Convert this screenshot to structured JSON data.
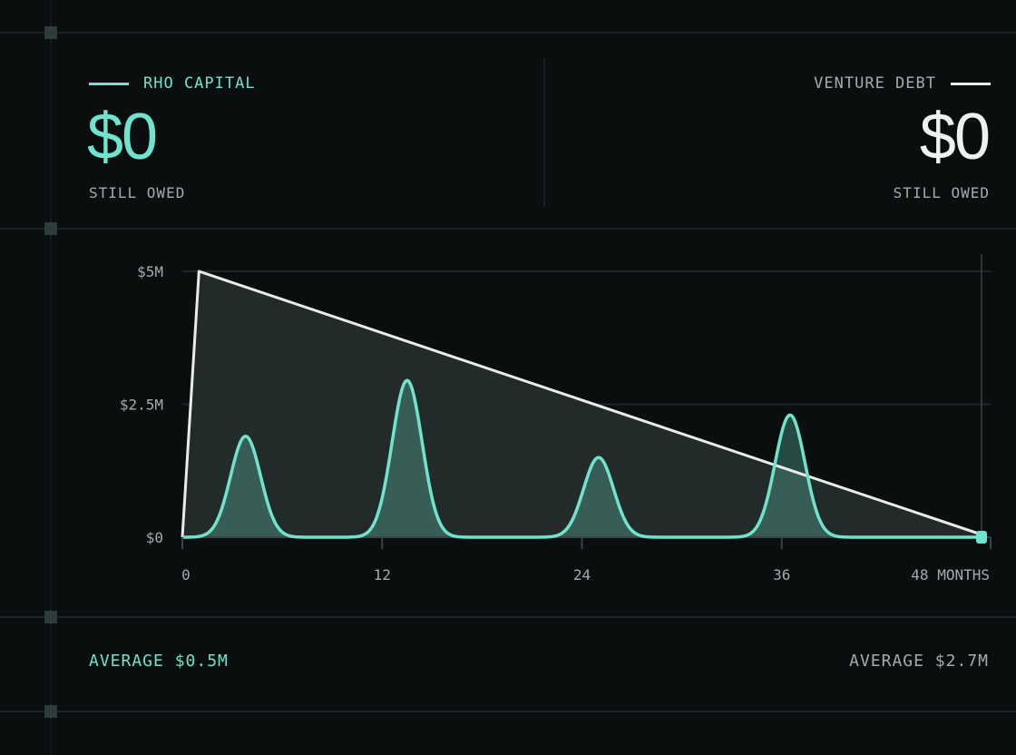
{
  "colors": {
    "rho": "#6fe3cc",
    "venture": "#e8ecea",
    "muted": "#a3acac",
    "grid": "#1e2627"
  },
  "summary": {
    "rho": {
      "label": "RHO CAPITAL",
      "amount": "$0",
      "sub": "STILL OWED",
      "average": "AVERAGE $0.5M"
    },
    "venture": {
      "label": "VENTURE DEBT",
      "amount": "$0",
      "sub": "STILL OWED",
      "average": "AVERAGE $2.7M"
    }
  },
  "chart_data": {
    "type": "area",
    "x_ticks": [
      "0",
      "12",
      "24",
      "36",
      "48 MONTHS"
    ],
    "x_tick_values": [
      0,
      12,
      24,
      36,
      48
    ],
    "y_ticks": [
      "$0",
      "$2.5M",
      "$5M"
    ],
    "y_tick_values": [
      0,
      2.5,
      5
    ],
    "xlim": [
      0,
      48
    ],
    "ylim": [
      0,
      5
    ],
    "grid": true,
    "series": [
      {
        "name": "VENTURE DEBT",
        "color": "#e8ecea",
        "points": [
          [
            0,
            0
          ],
          [
            1,
            5.0
          ],
          [
            48,
            0.05
          ]
        ]
      },
      {
        "name": "RHO CAPITAL",
        "color": "#6fe3cc",
        "peaks": [
          {
            "month": 3.8,
            "value": 1.9,
            "width": 0.9
          },
          {
            "month": 13.5,
            "value": 2.95,
            "width": 0.9
          },
          {
            "month": 25.0,
            "value": 1.5,
            "width": 0.9
          },
          {
            "month": 36.5,
            "value": 2.3,
            "width": 0.9
          }
        ]
      }
    ],
    "current_month": 48
  }
}
